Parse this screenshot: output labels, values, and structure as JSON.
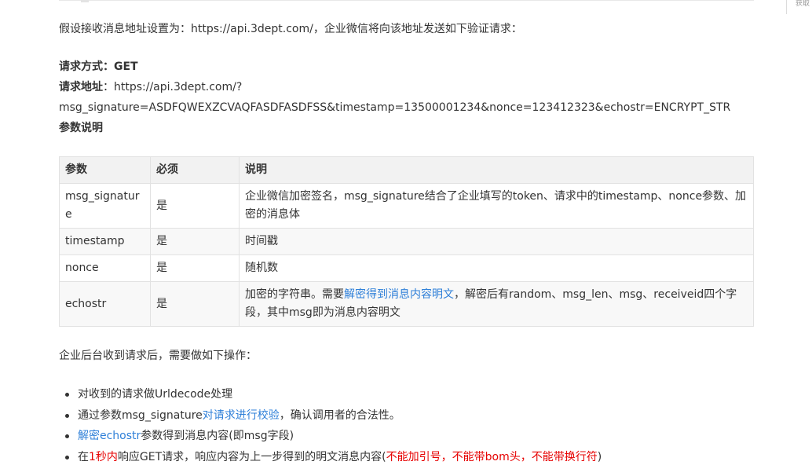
{
  "sidebar": {
    "text": "获取"
  },
  "intro": "假设接收消息地址设置为：https://api.3dept.com/，企业微信将向该地址发送如下验证请求：",
  "request": {
    "method_label": "请求方式：",
    "method_value": "GET",
    "url_label": "请求地址",
    "url_sep": "：",
    "url_line1": "https://api.3dept.com/?",
    "url_line2": "msg_signature=ASDFQWEXZCVAQFASDFASDFSS&timestamp=13500001234&nonce=123412323&echostr=ENCRYPT_STR",
    "params_title": "参数说明"
  },
  "table": {
    "headers": [
      "参数",
      "必须",
      "说明"
    ],
    "rows": [
      {
        "param": "msg_signature",
        "required": "是",
        "desc": "企业微信加密签名，msg_signature结合了企业填写的token、请求中的timestamp、nonce参数、加密的消息体"
      },
      {
        "param": "timestamp",
        "required": "是",
        "desc": "时间戳"
      },
      {
        "param": "nonce",
        "required": "是",
        "desc": "随机数"
      },
      {
        "param": "echostr",
        "required": "是",
        "desc_pre": "加密的字符串。需要",
        "desc_link": "解密得到消息内容明文",
        "desc_post": "，解密后有random、msg_len、msg、receiveid四个字段，其中msg即为消息内容明文"
      }
    ]
  },
  "after": "企业后台收到请求后，需要做如下操作：",
  "steps": [
    {
      "text": "对收到的请求做Urldecode处理"
    },
    {
      "pre": "通过参数msg_signature",
      "link": "对请求进行校验",
      "post": "，确认调用者的合法性。"
    },
    {
      "link": "解密echostr",
      "post": "参数得到消息内容(即msg字段)"
    },
    {
      "pre": "在",
      "red1": "1秒内",
      "mid": "响应GET请求，响应内容为上一步得到的明文消息内容(",
      "red2": "不能加引号，不能带bom头，不能带换行符",
      "post": ")"
    }
  ],
  "colors": {
    "link": "#2e7fd8",
    "warning": "#e60000",
    "header_bg": "#f2f2f2"
  }
}
